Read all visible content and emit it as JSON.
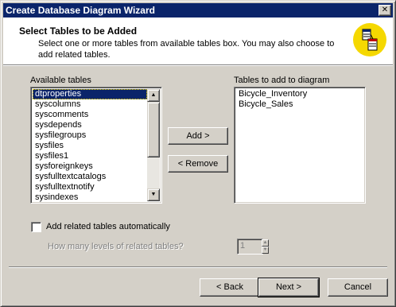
{
  "window": {
    "title": "Create Database Diagram Wizard",
    "close_glyph": "✕"
  },
  "header": {
    "title": "Select Tables to be Added",
    "description": "Select one or more tables from available tables box. You may also choose to add related tables.",
    "icon": "database-diagram-wizard-icon"
  },
  "available": {
    "label": "Available tables",
    "items": [
      "dtproperties",
      "syscolumns",
      "syscomments",
      "sysdepends",
      "sysfilegroups",
      "sysfiles",
      "sysfiles1",
      "sysforeignkeys",
      "sysfulltextcatalogs",
      "sysfulltextnotify",
      "sysindexes"
    ],
    "selected_index": 0
  },
  "target": {
    "label": "Tables to add to diagram",
    "items": [
      "Bicycle_Inventory",
      "Bicycle_Sales"
    ]
  },
  "actions": {
    "add_label": "Add >",
    "remove_label": "< Remove"
  },
  "related": {
    "checkbox_label": "Add related tables automatically",
    "checked": false,
    "levels_label": "How many levels of related tables?",
    "levels_value": "1"
  },
  "footer": {
    "back_label": "< Back",
    "next_label": "Next >",
    "cancel_label": "Cancel"
  },
  "colors": {
    "titlebar": "#0a246a",
    "face": "#d4d0c8",
    "selection": "#0a246a",
    "icon_circle": "#f5d800"
  }
}
